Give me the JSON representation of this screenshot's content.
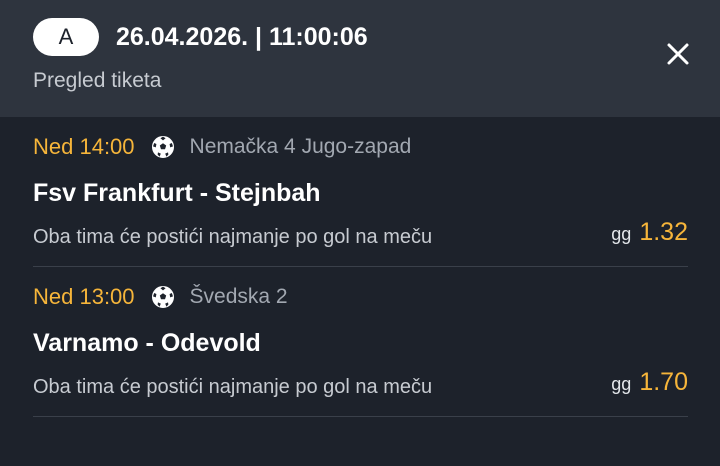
{
  "header": {
    "badge": "A",
    "datetime": "26.04.2026. | 11:00:06",
    "subtitle": "Pregled tiketa",
    "close_icon": "close-icon"
  },
  "matches": [
    {
      "time": "Ned 14:00",
      "sport_icon": "soccer-ball-icon",
      "league": "Nemačka 4 Jugo-zapad",
      "teams": "Fsv Frankfurt - Stejnbah",
      "market": "Oba tima će postići najmanje po gol na meču",
      "pick": "gg",
      "odd": "1.32"
    },
    {
      "time": "Ned 13:00",
      "sport_icon": "soccer-ball-icon",
      "league": "Švedska 2",
      "teams": "Varnamo - Odevold",
      "market": "Oba tima će postići najmanje po gol na meču",
      "pick": "gg",
      "odd": "1.70"
    }
  ],
  "colors": {
    "background": "#1d222b",
    "header_background": "#2e343e",
    "accent": "#f6b53a",
    "muted_text": "#a2a8b1"
  }
}
